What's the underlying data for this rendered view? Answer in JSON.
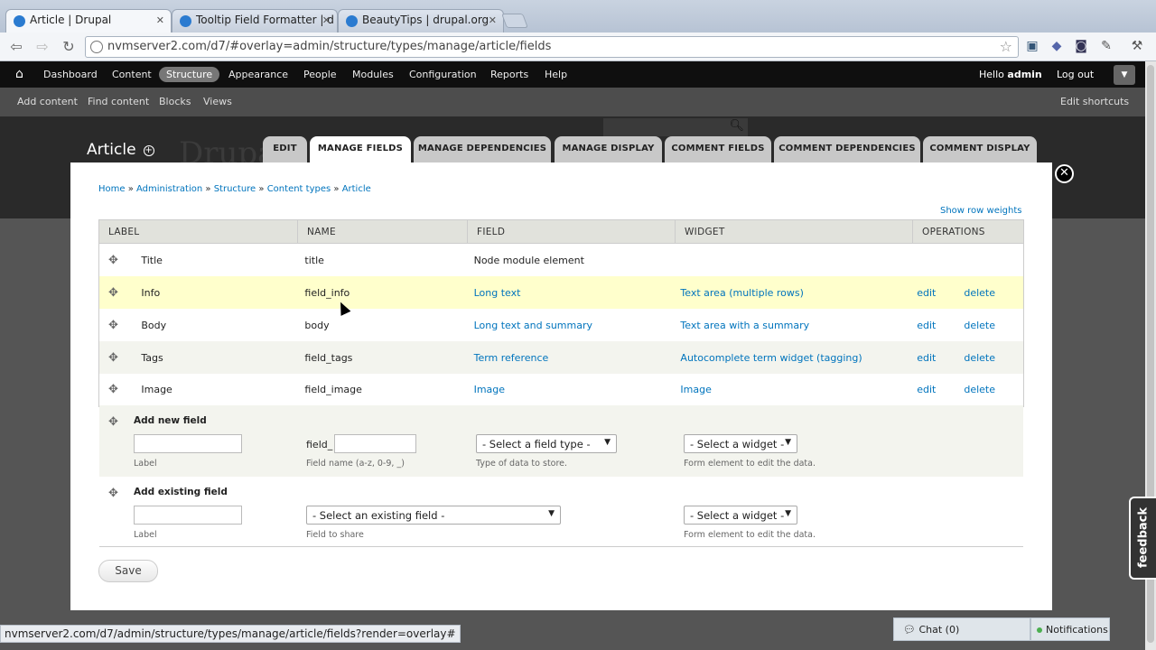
{
  "browser": {
    "tabs": [
      {
        "title": "Article | Drupal",
        "active": true
      },
      {
        "title": "Tooltip Field Formatter | d",
        "active": false
      },
      {
        "title": "BeautyTips | drupal.org",
        "active": false
      }
    ],
    "url": "nvmserver2.com/d7/#overlay=admin/structure/types/manage/article/fields",
    "status_url": "nvmserver2.com/d7/admin/structure/types/manage/article/fields?render=overlay#"
  },
  "admin_menu": {
    "items": [
      "Dashboard",
      "Content",
      "Structure",
      "Appearance",
      "People",
      "Modules",
      "Configuration",
      "Reports",
      "Help"
    ],
    "active": "Structure",
    "hello": "Hello ",
    "user": "admin",
    "logout": "Log out"
  },
  "shortcuts": {
    "items": [
      "Add content",
      "Find content",
      "Blocks",
      "Views"
    ],
    "edit": "Edit shortcuts"
  },
  "background_site_name": "Drupa",
  "page": {
    "title": "Article",
    "tabs": [
      "EDIT",
      "MANAGE FIELDS",
      "MANAGE DEPENDENCIES",
      "MANAGE DISPLAY",
      "COMMENT FIELDS",
      "COMMENT DEPENDENCIES",
      "COMMENT DISPLAY"
    ],
    "active_tab": "MANAGE FIELDS",
    "breadcrumb": [
      "Home",
      "Administration",
      "Structure",
      "Content types",
      "Article"
    ],
    "show_row_weights": "Show row weights"
  },
  "table": {
    "headers": [
      "LABEL",
      "NAME",
      "FIELD",
      "WIDGET",
      "OPERATIONS"
    ],
    "rows": [
      {
        "label": "Title",
        "name": "title",
        "field": "Node module element",
        "widget": "",
        "edit": "",
        "delete": ""
      },
      {
        "label": "Info",
        "name": "field_info",
        "field": "Long text",
        "widget": "Text area (multiple rows)",
        "edit": "edit",
        "delete": "delete"
      },
      {
        "label": "Body",
        "name": "body",
        "field": "Long text and summary",
        "widget": "Text area with a summary",
        "edit": "edit",
        "delete": "delete"
      },
      {
        "label": "Tags",
        "name": "field_tags",
        "field": "Term reference",
        "widget": "Autocomplete term widget (tagging)",
        "edit": "edit",
        "delete": "delete"
      },
      {
        "label": "Image",
        "name": "field_image",
        "field": "Image",
        "widget": "Image",
        "edit": "edit",
        "delete": "delete"
      }
    ]
  },
  "add_new": {
    "title": "Add new field",
    "label_hint": "Label",
    "prefix": "field_",
    "name_hint": "Field name (a-z, 0-9, _)",
    "type_select": "- Select a field type -",
    "type_hint": "Type of data to store.",
    "widget_select": "- Select a widget -",
    "widget_hint": "Form element to edit the data."
  },
  "add_existing": {
    "title": "Add existing field",
    "label_hint": "Label",
    "field_select": "- Select an existing field -",
    "field_hint": "Field to share",
    "widget_select": "- Select a widget -",
    "widget_hint": "Form element to edit the data."
  },
  "save": "Save",
  "feedback": "feedback",
  "chat": "Chat  (0)",
  "notifications": "Notifications"
}
